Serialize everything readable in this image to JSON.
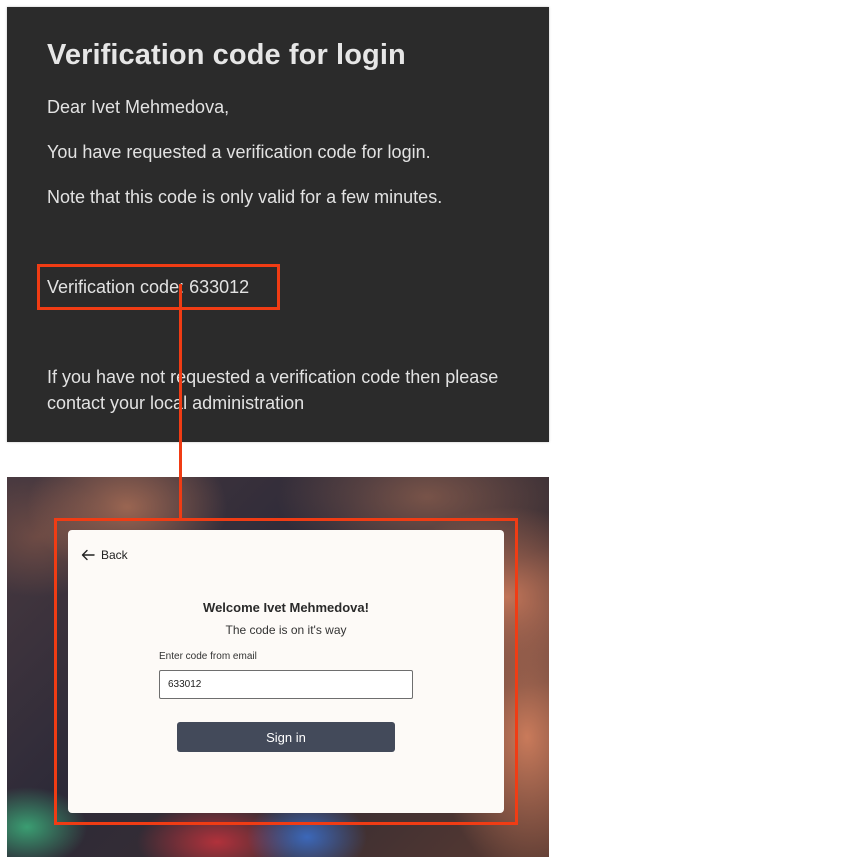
{
  "email": {
    "title": "Verification code for login",
    "greeting": "Dear Ivet Mehmedova,",
    "request_line": "You have requested a verification code for login.",
    "note_line": "Note that this code is only valid for a few minutes.",
    "code_line": "Verification code: 633012",
    "contact_line": "If you have not requested a verification code then please contact your local administration"
  },
  "login": {
    "back_label": "Back",
    "back_icon": "arrow-left-icon",
    "welcome": "Welcome Ivet Mehmedova!",
    "subtitle": "The code is on it's way",
    "code_field_label": "Enter code from email",
    "code_field_value": "633012",
    "sign_in_label": "Sign in"
  },
  "colors": {
    "email_background": "#2b2b2b",
    "highlight": "#f03c14",
    "card_background": "#fdfaf7",
    "button_background": "#434a5a"
  }
}
